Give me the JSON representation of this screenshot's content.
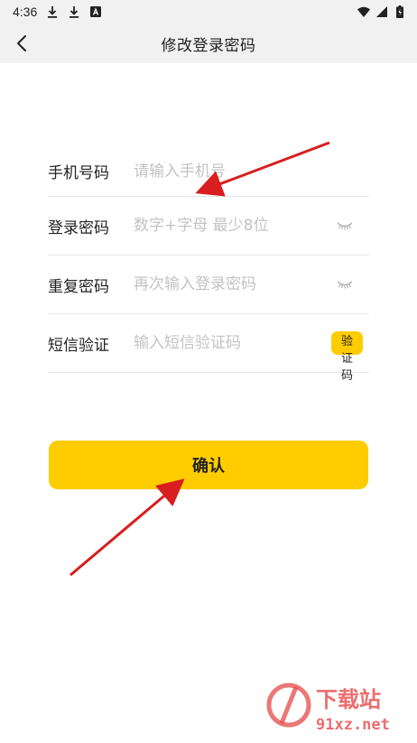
{
  "status_bar": {
    "time": "4:36",
    "left_icons": [
      "download-icon",
      "download-icon",
      "app-a-icon"
    ],
    "right_icons": [
      "wifi-icon",
      "signal-icon",
      "battery-charging-icon"
    ]
  },
  "nav": {
    "back_icon": "chevron-left-icon",
    "title": "修改登录密码"
  },
  "form": {
    "phone": {
      "label": "手机号码",
      "placeholder": "请输入手机号"
    },
    "password": {
      "label": "登录密码",
      "placeholder": "数字+字母 最少8位",
      "toggle_icon": "eye-closed-icon"
    },
    "repeat_password": {
      "label": "重复密码",
      "placeholder": "再次输入登录密码",
      "toggle_icon": "eye-closed-icon"
    },
    "sms": {
      "label": "短信验证",
      "placeholder": "输入短信验证码",
      "button": "验证码"
    }
  },
  "confirm_button": "确认",
  "watermark": {
    "brand": "下载站",
    "domain": "91xz.net"
  },
  "colors": {
    "accent": "#ffcc00",
    "arrow": "#d81e1e",
    "placeholder": "#c3c3c3",
    "watermark": "#e64a4a"
  }
}
